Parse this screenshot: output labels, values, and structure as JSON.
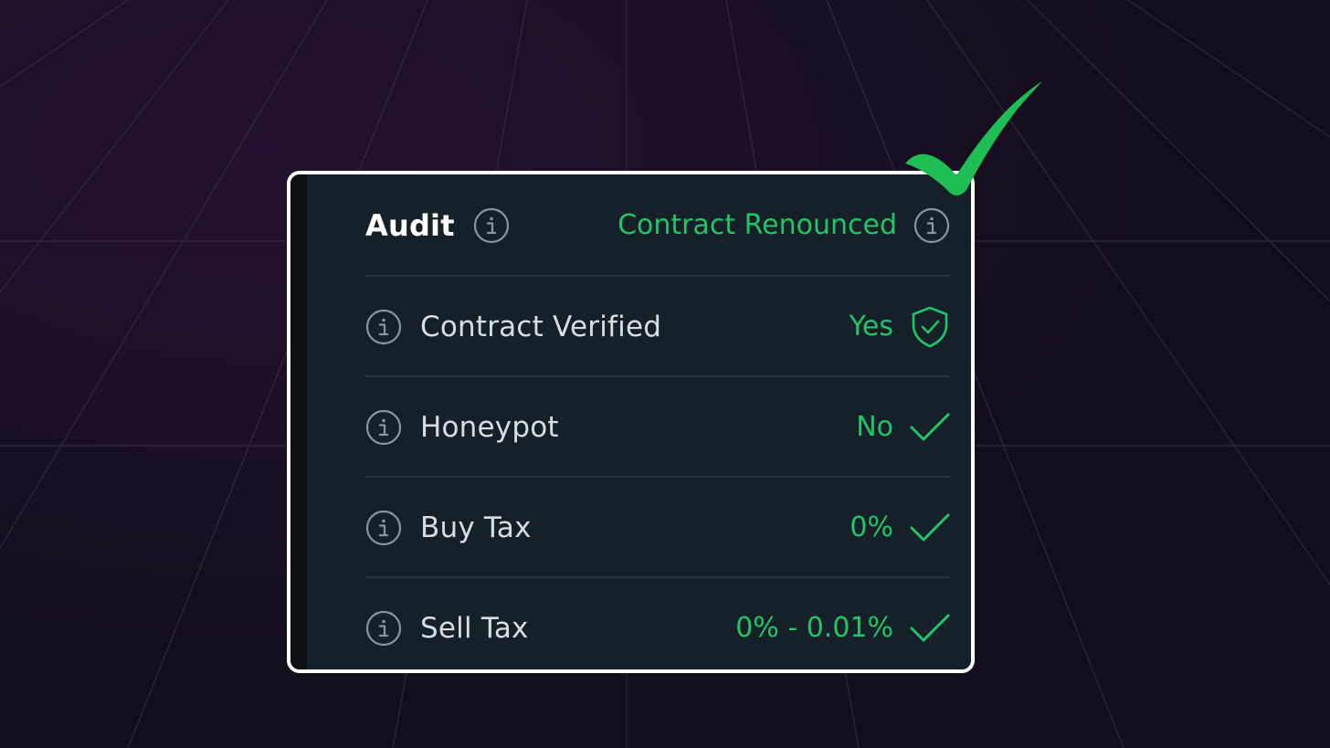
{
  "header": {
    "title": "Audit",
    "status": "Contract Renounced"
  },
  "rows": [
    {
      "label": "Contract Verified",
      "value": "Yes",
      "icon": "shield-check-icon"
    },
    {
      "label": "Honeypot",
      "value": "No",
      "icon": "check-icon"
    },
    {
      "label": "Buy Tax",
      "value": "0%",
      "icon": "check-icon"
    },
    {
      "label": "Sell Tax",
      "value": "0% - 0.01%",
      "icon": "check-icon"
    }
  ],
  "colors": {
    "accent": "#22c468",
    "background": "#130e1d",
    "card": "#152028",
    "border": "#ffffff",
    "overlay_check": "#1fbe55"
  }
}
